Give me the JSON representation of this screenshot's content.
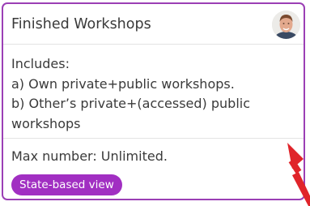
{
  "card": {
    "title": "Finished Workshops",
    "description_lines": [
      "Includes:",
      "a) Own private+public workshops.",
      "b) Other’s private+(accessed) public",
      "workshops"
    ],
    "max_number": "Max number: Unlimited.",
    "view_badge": "State-based view"
  },
  "colors": {
    "card_border": "#9b3fb5",
    "badge_background": "#a12fc2",
    "badge_text": "#ffffff",
    "text": "#3a3a3a",
    "annotation_arrow": "#e0242a"
  },
  "icons": {
    "avatar": "user-avatar",
    "annotation": "red-arrow"
  }
}
